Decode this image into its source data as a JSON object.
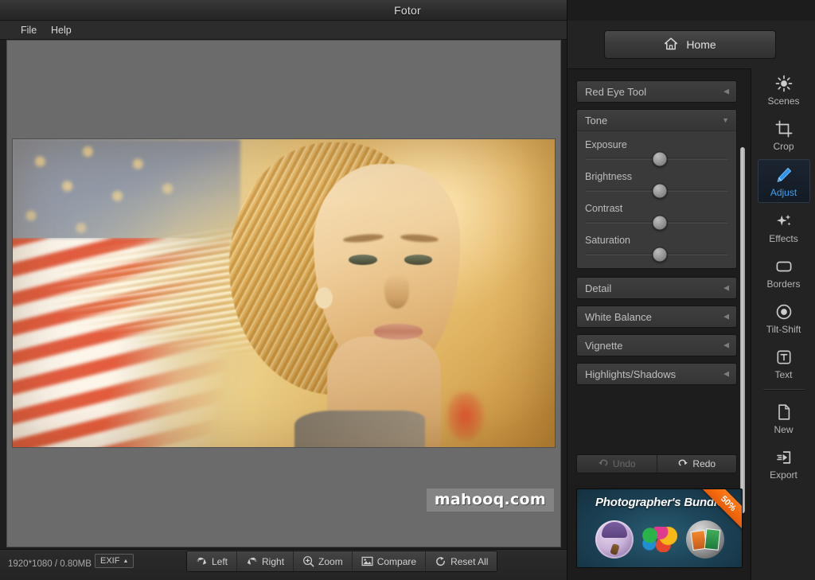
{
  "window": {
    "title": "Fotor",
    "controls": [
      {
        "name": "minimize",
        "glyph": "–"
      },
      {
        "name": "maximize",
        "glyph": "❐"
      },
      {
        "name": "close",
        "glyph": "✕"
      }
    ]
  },
  "menubar": {
    "items": [
      {
        "label": "File"
      },
      {
        "label": "Help"
      }
    ]
  },
  "home": {
    "label": "Home",
    "icon": "home-icon"
  },
  "adjust_panel": {
    "sections": [
      {
        "title": "Red Eye Tool",
        "state": "collapsed",
        "arrow": "◀"
      },
      {
        "title": "Tone",
        "state": "expanded",
        "arrow": "▼"
      },
      {
        "title": "Detail",
        "state": "collapsed",
        "arrow": "◀"
      },
      {
        "title": "White Balance",
        "state": "collapsed",
        "arrow": "◀"
      },
      {
        "title": "Vignette",
        "state": "collapsed",
        "arrow": "◀"
      },
      {
        "title": "Highlights/Shadows",
        "state": "collapsed",
        "arrow": "◀"
      }
    ],
    "tone_sliders": [
      {
        "label": "Exposure",
        "position_pct": 52
      },
      {
        "label": "Brightness",
        "position_pct": 52
      },
      {
        "label": "Contrast",
        "position_pct": 52
      },
      {
        "label": "Saturation",
        "position_pct": 52
      }
    ],
    "undo": {
      "label": "Undo",
      "enabled": false,
      "icon": "undo-arrow-icon"
    },
    "redo": {
      "label": "Redo",
      "enabled": true,
      "icon": "redo-arrow-icon"
    }
  },
  "ad": {
    "title": "Photographer's Bundle",
    "ribbon": "50%"
  },
  "rail": {
    "items": [
      {
        "label": "Scenes",
        "icon": "sun-icon",
        "active": false
      },
      {
        "label": "Crop",
        "icon": "crop-icon",
        "active": false
      },
      {
        "label": "Adjust",
        "icon": "pencil-icon",
        "active": true
      },
      {
        "label": "Effects",
        "icon": "sparkle-icon",
        "active": false
      },
      {
        "label": "Borders",
        "icon": "rounded-rect-icon",
        "active": false
      },
      {
        "label": "Tilt-Shift",
        "icon": "target-circle-icon",
        "active": false
      },
      {
        "label": "Text",
        "icon": "text-t-icon",
        "active": false
      }
    ],
    "items_bottom": [
      {
        "label": "New",
        "icon": "page-icon",
        "active": false
      },
      {
        "label": "Export",
        "icon": "export-arrow-icon",
        "active": false
      }
    ]
  },
  "statusbar": {
    "image_info": "1920*1080 / 0.80MB",
    "exif_label": "EXIF",
    "exif_arrow": "▲",
    "tools": [
      {
        "label": "Left",
        "icon": "rotate-left-icon"
      },
      {
        "label": "Right",
        "icon": "rotate-right-icon"
      },
      {
        "label": "Zoom",
        "icon": "zoom-plus-icon"
      },
      {
        "label": "Compare",
        "icon": "compare-image-icon"
      },
      {
        "label": "Reset All",
        "icon": "reset-circular-icon"
      }
    ]
  },
  "canvas": {
    "watermark": "mahooq.com"
  },
  "colors": {
    "accent_blue": "#3e9ff0",
    "panel_bg": "#1d1d1d",
    "canvas_bg": "#6b6b6b",
    "ribbon_orange": "#ff7a18"
  }
}
